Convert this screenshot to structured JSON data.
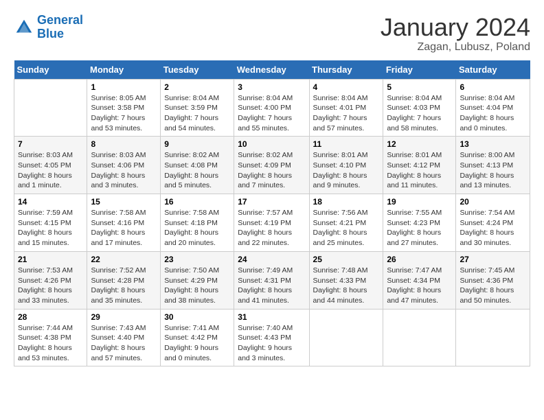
{
  "logo": {
    "line1": "General",
    "line2": "Blue"
  },
  "title": "January 2024",
  "subtitle": "Zagan, Lubusz, Poland",
  "days_of_week": [
    "Sunday",
    "Monday",
    "Tuesday",
    "Wednesday",
    "Thursday",
    "Friday",
    "Saturday"
  ],
  "weeks": [
    [
      {
        "num": "",
        "sunrise": "",
        "sunset": "",
        "daylight": ""
      },
      {
        "num": "1",
        "sunrise": "Sunrise: 8:05 AM",
        "sunset": "Sunset: 3:58 PM",
        "daylight": "Daylight: 7 hours and 53 minutes."
      },
      {
        "num": "2",
        "sunrise": "Sunrise: 8:04 AM",
        "sunset": "Sunset: 3:59 PM",
        "daylight": "Daylight: 7 hours and 54 minutes."
      },
      {
        "num": "3",
        "sunrise": "Sunrise: 8:04 AM",
        "sunset": "Sunset: 4:00 PM",
        "daylight": "Daylight: 7 hours and 55 minutes."
      },
      {
        "num": "4",
        "sunrise": "Sunrise: 8:04 AM",
        "sunset": "Sunset: 4:01 PM",
        "daylight": "Daylight: 7 hours and 57 minutes."
      },
      {
        "num": "5",
        "sunrise": "Sunrise: 8:04 AM",
        "sunset": "Sunset: 4:03 PM",
        "daylight": "Daylight: 7 hours and 58 minutes."
      },
      {
        "num": "6",
        "sunrise": "Sunrise: 8:04 AM",
        "sunset": "Sunset: 4:04 PM",
        "daylight": "Daylight: 8 hours and 0 minutes."
      }
    ],
    [
      {
        "num": "7",
        "sunrise": "Sunrise: 8:03 AM",
        "sunset": "Sunset: 4:05 PM",
        "daylight": "Daylight: 8 hours and 1 minute."
      },
      {
        "num": "8",
        "sunrise": "Sunrise: 8:03 AM",
        "sunset": "Sunset: 4:06 PM",
        "daylight": "Daylight: 8 hours and 3 minutes."
      },
      {
        "num": "9",
        "sunrise": "Sunrise: 8:02 AM",
        "sunset": "Sunset: 4:08 PM",
        "daylight": "Daylight: 8 hours and 5 minutes."
      },
      {
        "num": "10",
        "sunrise": "Sunrise: 8:02 AM",
        "sunset": "Sunset: 4:09 PM",
        "daylight": "Daylight: 8 hours and 7 minutes."
      },
      {
        "num": "11",
        "sunrise": "Sunrise: 8:01 AM",
        "sunset": "Sunset: 4:10 PM",
        "daylight": "Daylight: 8 hours and 9 minutes."
      },
      {
        "num": "12",
        "sunrise": "Sunrise: 8:01 AM",
        "sunset": "Sunset: 4:12 PM",
        "daylight": "Daylight: 8 hours and 11 minutes."
      },
      {
        "num": "13",
        "sunrise": "Sunrise: 8:00 AM",
        "sunset": "Sunset: 4:13 PM",
        "daylight": "Daylight: 8 hours and 13 minutes."
      }
    ],
    [
      {
        "num": "14",
        "sunrise": "Sunrise: 7:59 AM",
        "sunset": "Sunset: 4:15 PM",
        "daylight": "Daylight: 8 hours and 15 minutes."
      },
      {
        "num": "15",
        "sunrise": "Sunrise: 7:58 AM",
        "sunset": "Sunset: 4:16 PM",
        "daylight": "Daylight: 8 hours and 17 minutes."
      },
      {
        "num": "16",
        "sunrise": "Sunrise: 7:58 AM",
        "sunset": "Sunset: 4:18 PM",
        "daylight": "Daylight: 8 hours and 20 minutes."
      },
      {
        "num": "17",
        "sunrise": "Sunrise: 7:57 AM",
        "sunset": "Sunset: 4:19 PM",
        "daylight": "Daylight: 8 hours and 22 minutes."
      },
      {
        "num": "18",
        "sunrise": "Sunrise: 7:56 AM",
        "sunset": "Sunset: 4:21 PM",
        "daylight": "Daylight: 8 hours and 25 minutes."
      },
      {
        "num": "19",
        "sunrise": "Sunrise: 7:55 AM",
        "sunset": "Sunset: 4:23 PM",
        "daylight": "Daylight: 8 hours and 27 minutes."
      },
      {
        "num": "20",
        "sunrise": "Sunrise: 7:54 AM",
        "sunset": "Sunset: 4:24 PM",
        "daylight": "Daylight: 8 hours and 30 minutes."
      }
    ],
    [
      {
        "num": "21",
        "sunrise": "Sunrise: 7:53 AM",
        "sunset": "Sunset: 4:26 PM",
        "daylight": "Daylight: 8 hours and 33 minutes."
      },
      {
        "num": "22",
        "sunrise": "Sunrise: 7:52 AM",
        "sunset": "Sunset: 4:28 PM",
        "daylight": "Daylight: 8 hours and 35 minutes."
      },
      {
        "num": "23",
        "sunrise": "Sunrise: 7:50 AM",
        "sunset": "Sunset: 4:29 PM",
        "daylight": "Daylight: 8 hours and 38 minutes."
      },
      {
        "num": "24",
        "sunrise": "Sunrise: 7:49 AM",
        "sunset": "Sunset: 4:31 PM",
        "daylight": "Daylight: 8 hours and 41 minutes."
      },
      {
        "num": "25",
        "sunrise": "Sunrise: 7:48 AM",
        "sunset": "Sunset: 4:33 PM",
        "daylight": "Daylight: 8 hours and 44 minutes."
      },
      {
        "num": "26",
        "sunrise": "Sunrise: 7:47 AM",
        "sunset": "Sunset: 4:34 PM",
        "daylight": "Daylight: 8 hours and 47 minutes."
      },
      {
        "num": "27",
        "sunrise": "Sunrise: 7:45 AM",
        "sunset": "Sunset: 4:36 PM",
        "daylight": "Daylight: 8 hours and 50 minutes."
      }
    ],
    [
      {
        "num": "28",
        "sunrise": "Sunrise: 7:44 AM",
        "sunset": "Sunset: 4:38 PM",
        "daylight": "Daylight: 8 hours and 53 minutes."
      },
      {
        "num": "29",
        "sunrise": "Sunrise: 7:43 AM",
        "sunset": "Sunset: 4:40 PM",
        "daylight": "Daylight: 8 hours and 57 minutes."
      },
      {
        "num": "30",
        "sunrise": "Sunrise: 7:41 AM",
        "sunset": "Sunset: 4:42 PM",
        "daylight": "Daylight: 9 hours and 0 minutes."
      },
      {
        "num": "31",
        "sunrise": "Sunrise: 7:40 AM",
        "sunset": "Sunset: 4:43 PM",
        "daylight": "Daylight: 9 hours and 3 minutes."
      },
      {
        "num": "",
        "sunrise": "",
        "sunset": "",
        "daylight": ""
      },
      {
        "num": "",
        "sunrise": "",
        "sunset": "",
        "daylight": ""
      },
      {
        "num": "",
        "sunrise": "",
        "sunset": "",
        "daylight": ""
      }
    ]
  ]
}
